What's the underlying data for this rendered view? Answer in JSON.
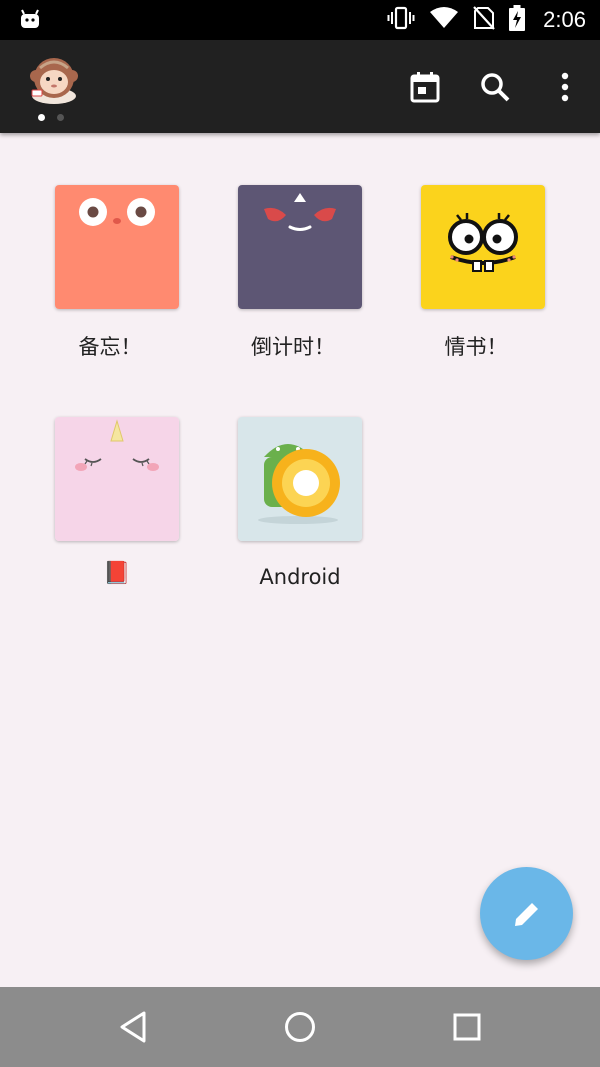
{
  "status_bar": {
    "time": "2:06",
    "icons": [
      "android-notification-icon",
      "vibrate-icon",
      "wifi-icon",
      "no-sim-icon",
      "battery-charging-icon"
    ]
  },
  "app_bar": {
    "avatar": "monkey-avatar",
    "page_indicator": {
      "count": 2,
      "active_index": 0
    },
    "actions": [
      "calendar-icon",
      "search-icon",
      "more-vert-icon"
    ]
  },
  "notebooks": [
    {
      "label": "备忘！",
      "color": "#ff8a70",
      "cover": "orange-eyes-face"
    },
    {
      "label": "倒计时！",
      "color": "#5d5674",
      "cover": "angry-purple-face"
    },
    {
      "label": "情书！",
      "color": "#fbd31c",
      "cover": "spongebob-face"
    },
    {
      "label": "📕",
      "color": "#f6d5e8",
      "cover": "pink-unicorn-face"
    },
    {
      "label": "Android",
      "color": "#d8e6ea",
      "cover": "android-oreo"
    }
  ],
  "fab": {
    "icon": "pencil-icon",
    "color": "#6ab7e8"
  },
  "nav_bar": {
    "buttons": [
      "back-icon",
      "home-icon",
      "recents-icon"
    ]
  }
}
